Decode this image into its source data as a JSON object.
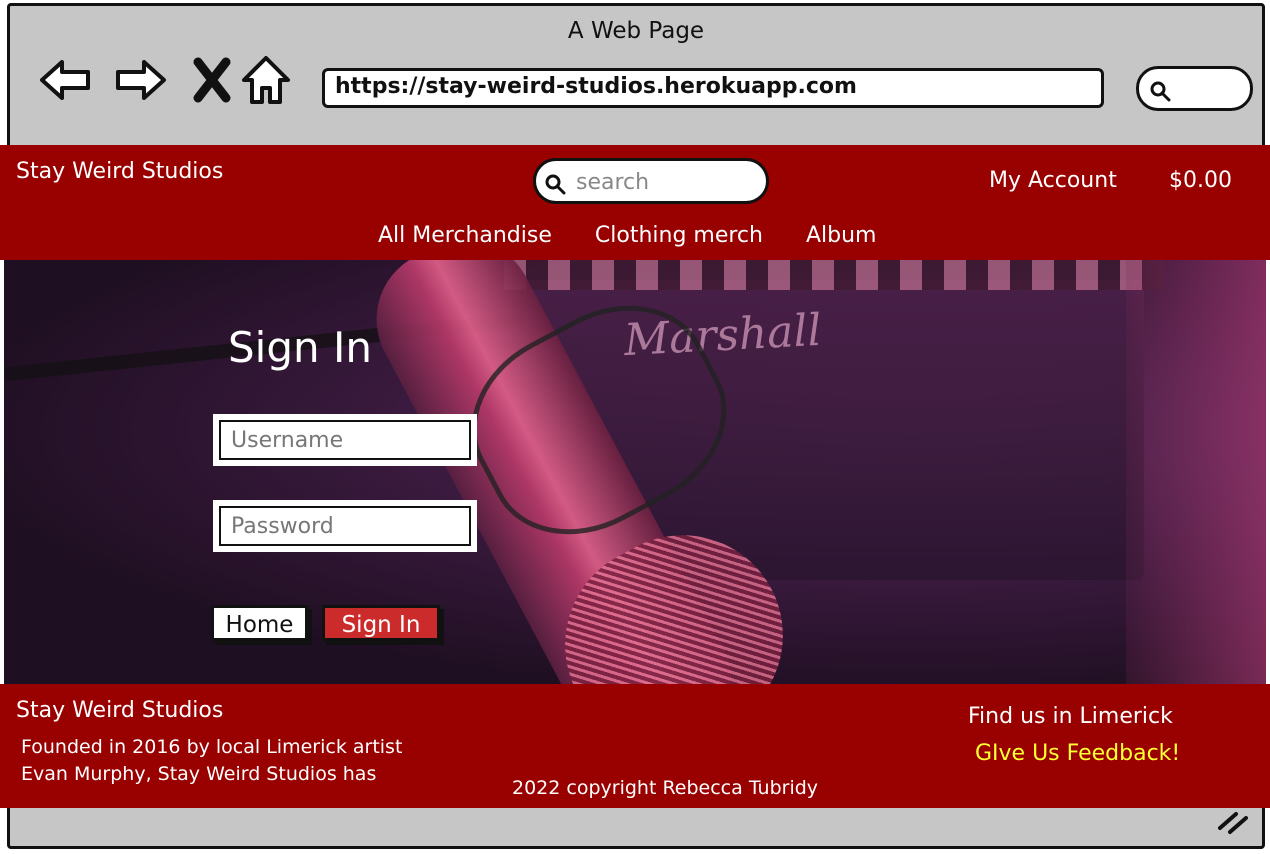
{
  "browser": {
    "window_title": "A Web Page",
    "url": "https://stay-weird-studios.herokuapp.com",
    "nav_icons": [
      "back-arrow-icon",
      "forward-arrow-icon",
      "close-icon",
      "home-icon"
    ]
  },
  "header": {
    "brand": "Stay Weird Studios",
    "search_placeholder": "search",
    "account_label": "My Account",
    "bag_total": "$0.00",
    "nav": [
      "All Merchandise",
      "Clothing merch",
      "Album"
    ]
  },
  "signin": {
    "title": "Sign In",
    "username_placeholder": "Username",
    "password_placeholder": "Password",
    "home_button": "Home",
    "signin_button": "Sign In"
  },
  "footer": {
    "brand": "Stay Weird Studios",
    "about_line1": "Founded in 2016 by local Limerick artist",
    "about_line2": "Evan Murphy, Stay Weird Studios has",
    "copyright": "2022 copyright Rebecca Tubridy",
    "find_us": "Find us in Limerick",
    "feedback": "GIve Us Feedback!"
  },
  "colors": {
    "header_bg": "#990000",
    "signin_button_bg": "#cc2b2b",
    "feedback_text": "#ffff33",
    "browser_chrome": "#c6c6c6"
  }
}
